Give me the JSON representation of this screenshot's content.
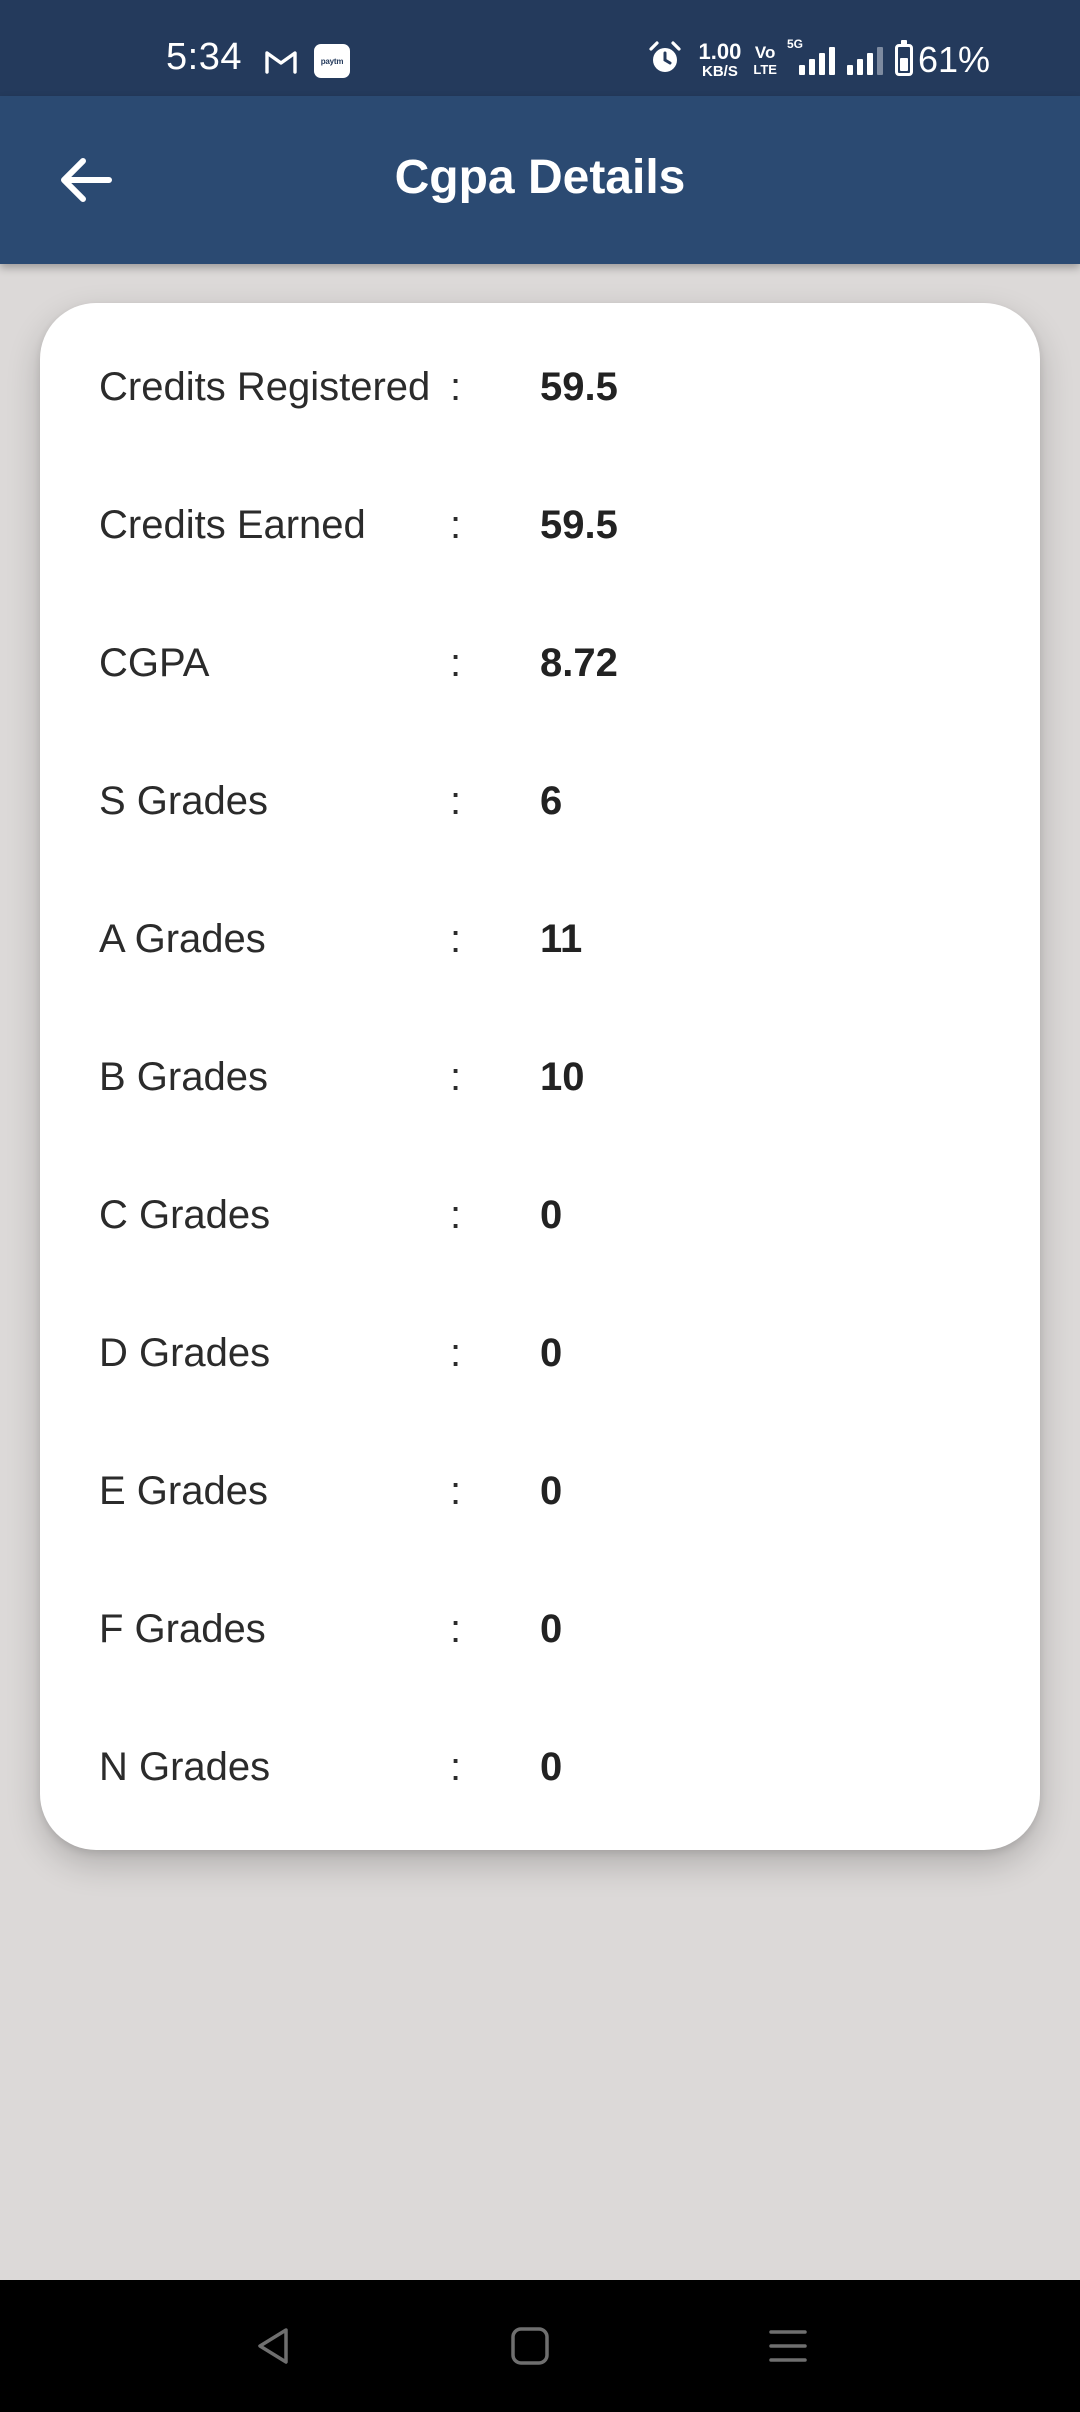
{
  "status_bar": {
    "time": "5:34",
    "app_icons": [
      "gmail-icon",
      "paytm-icon"
    ],
    "paytm_label": "paytm",
    "net_speed_value": "1.00",
    "net_speed_unit": "KB/S",
    "volte_top": "Vo",
    "volte_bottom": "LTE",
    "network_tag": "5G",
    "battery_percent": "61%",
    "battery_level": 0.61
  },
  "app_bar": {
    "back_icon": "arrow-left-icon",
    "title": "Cgpa Details"
  },
  "details": [
    {
      "label": "Credits Registered",
      "separator": ":",
      "value": "59.5"
    },
    {
      "label": "Credits Earned",
      "separator": ":",
      "value": "59.5"
    },
    {
      "label": "CGPA",
      "separator": ":",
      "value": "8.72"
    },
    {
      "label": "S Grades",
      "separator": ":",
      "value": "6"
    },
    {
      "label": "A Grades",
      "separator": ":",
      "value": "11"
    },
    {
      "label": "B Grades",
      "separator": ":",
      "value": "10"
    },
    {
      "label": "C Grades",
      "separator": ":",
      "value": "0"
    },
    {
      "label": "D Grades",
      "separator": ":",
      "value": "0"
    },
    {
      "label": "E Grades",
      "separator": ":",
      "value": "0"
    },
    {
      "label": "F Grades",
      "separator": ":",
      "value": "0"
    },
    {
      "label": "N Grades",
      "separator": ":",
      "value": "0"
    }
  ],
  "nav_bar": {
    "buttons": [
      "back-triangle-icon",
      "home-square-icon",
      "menu-lines-icon"
    ]
  },
  "colors": {
    "status_bar_bg": "#243a5c",
    "app_bar_bg": "#2b4a72",
    "page_bg": "#dcd9d8",
    "card_bg": "#ffffff",
    "nav_bar_bg": "#000000"
  }
}
